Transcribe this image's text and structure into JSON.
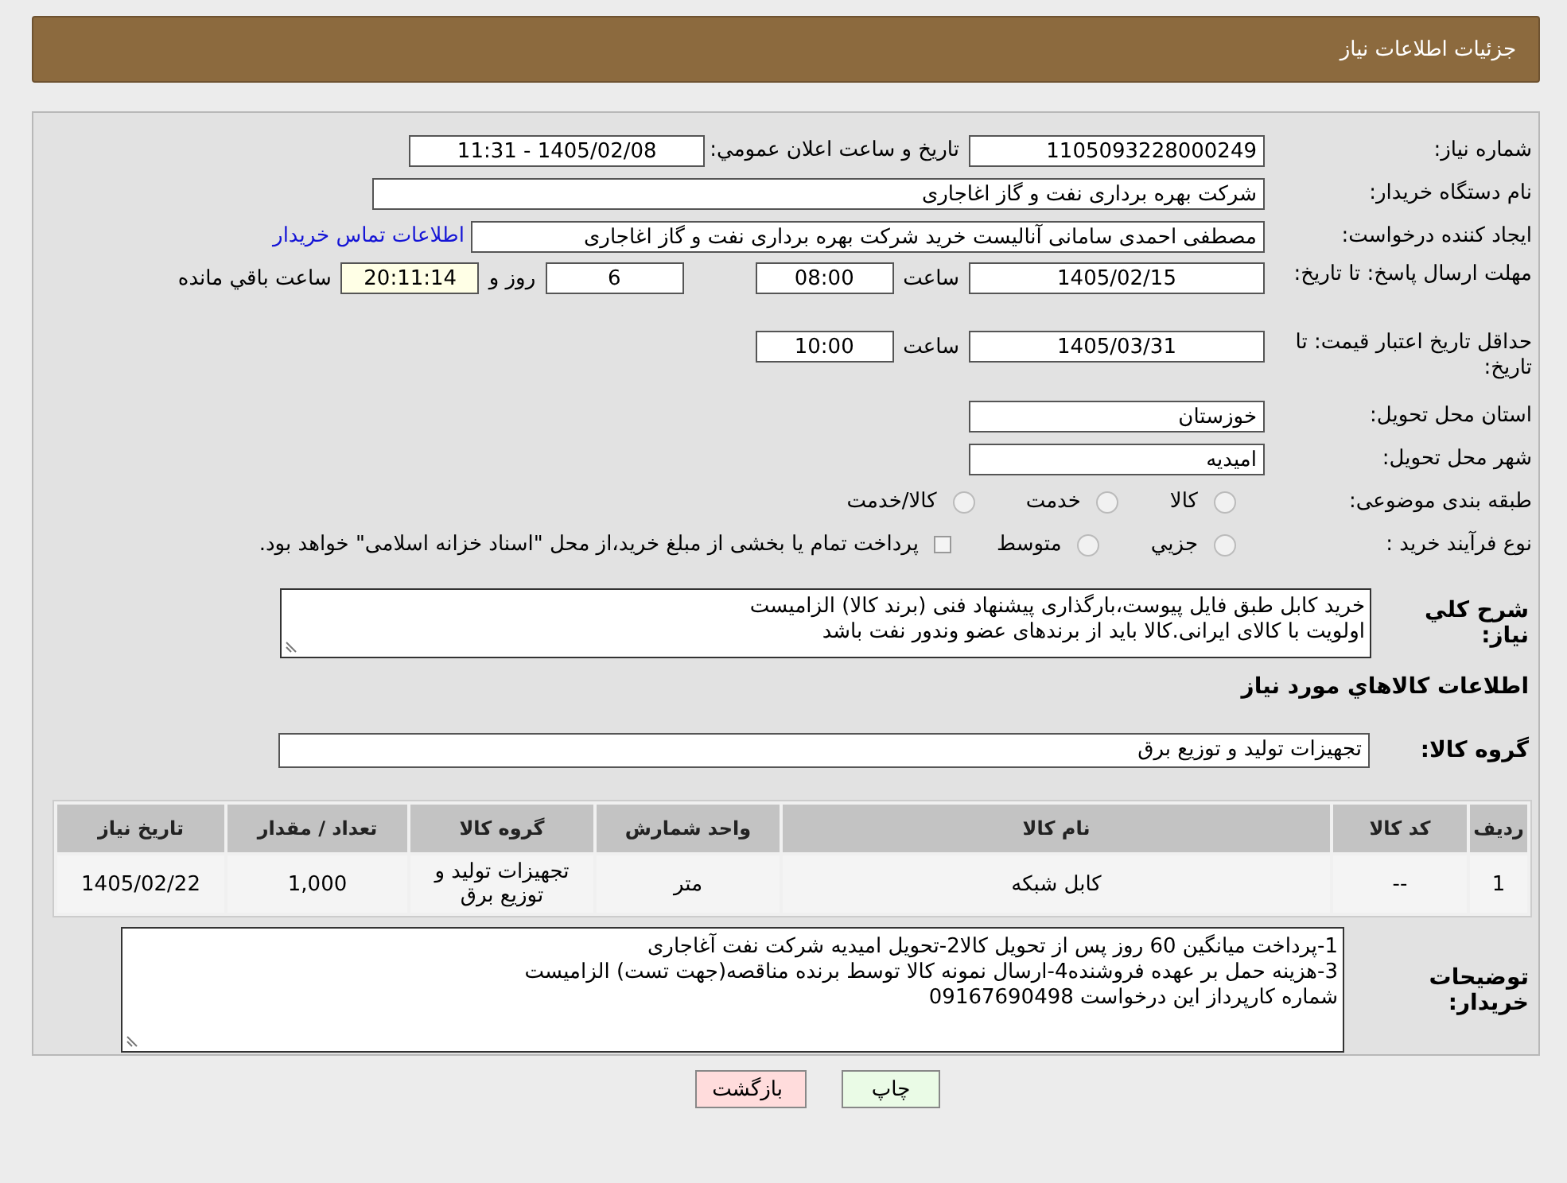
{
  "header": {
    "title": "جزئیات اطلاعات نیاز"
  },
  "need_number": {
    "label": "شماره نیاز:",
    "value": "1105093228000249"
  },
  "announce": {
    "label": "تاریخ و ساعت اعلان عمومي:",
    "value": "1405/02/08 - 11:31"
  },
  "buyer_org": {
    "label": "نام دستگاه خريدار:",
    "value": "شرکت بهره برداری نفت و گاز اغاجاری"
  },
  "requester": {
    "label": "ایجاد کننده درخواست:",
    "value": "مصطفی احمدی سامانی آنالیست خرید شرکت بهره برداری نفت و گاز اغاجاری",
    "link": "اطلاعات تماس خريدار"
  },
  "reply_deadline": {
    "label": "مهلت ارسال پاسخ: تا تاریخ:",
    "date": "1405/02/15",
    "time_label": "ساعت",
    "time": "08:00",
    "days": "6",
    "days_label": "روز و",
    "remaining": "20:11:14",
    "remaining_label": "ساعت باقي مانده"
  },
  "price_validity": {
    "label": "حداقل تاریخ اعتبار قیمت: تا تاریخ:",
    "date": "1405/03/31",
    "time_label": "ساعت",
    "time": "10:00"
  },
  "province": {
    "label": "استان محل تحویل:",
    "value": "خوزستان"
  },
  "city": {
    "label": "شهر محل تحویل:",
    "value": "امیدیه"
  },
  "category": {
    "label": "طبقه بندی موضوعی:",
    "options": [
      {
        "label": "كالا",
        "selected": false
      },
      {
        "label": "خدمت",
        "selected": false
      },
      {
        "label": "كالا/خدمت",
        "selected": false
      }
    ]
  },
  "purchase_type": {
    "label": "نوع فرآیند خرید :",
    "options": [
      {
        "label": "جزيي",
        "selected": false
      },
      {
        "label": "متوسط",
        "selected": false
      }
    ],
    "payment": {
      "text": "پرداخت تمام یا بخشی از مبلغ خرید،از محل \"اسناد خزانه اسلامی\" خواهد بود.",
      "checked": false
    }
  },
  "description": {
    "label": "شرح کلي نياز:",
    "lines": [
      "خرید کابل طبق فایل پیوست،بارگذاری پیشنهاد فنی (برند کالا) الزامیست",
      "اولویت با کالای ایرانی.کالا باید از برندهای عضو وندور نفت باشد"
    ]
  },
  "goods_title": "اطلاعات کالاهاي مورد نياز",
  "goods_group": {
    "label": "گروه کالا:",
    "value": "تجهیزات تولید و توزیع برق"
  },
  "table": {
    "columns": [
      "رديف",
      "کد کالا",
      "نام کالا",
      "واحد شمارش",
      "گروه کالا",
      "تعداد / مقدار",
      "تاریخ نیاز"
    ],
    "rows": [
      [
        "1",
        "--",
        "کابل شبکه",
        "متر",
        "تجهیزات تولید و توزیع برق",
        "1,000",
        "1405/02/22"
      ]
    ]
  },
  "buyer_notes": {
    "label": "توضیحات خریدار:",
    "lines": [
      "1-پرداخت میانگین 60 روز پس از تحویل کالا2-تحویل امیدیه شرکت نفت آغاجاری",
      "3-هزینه حمل بر عهده فروشنده4-ارسال نمونه کالا توسط برنده مناقصه(جهت تست) الزامیست",
      "شماره کارپرداز این درخواست 09167690498"
    ]
  },
  "buttons": [
    {
      "label": "چاپ",
      "kind": "print"
    },
    {
      "label": "بازگشت",
      "kind": "back"
    }
  ]
}
